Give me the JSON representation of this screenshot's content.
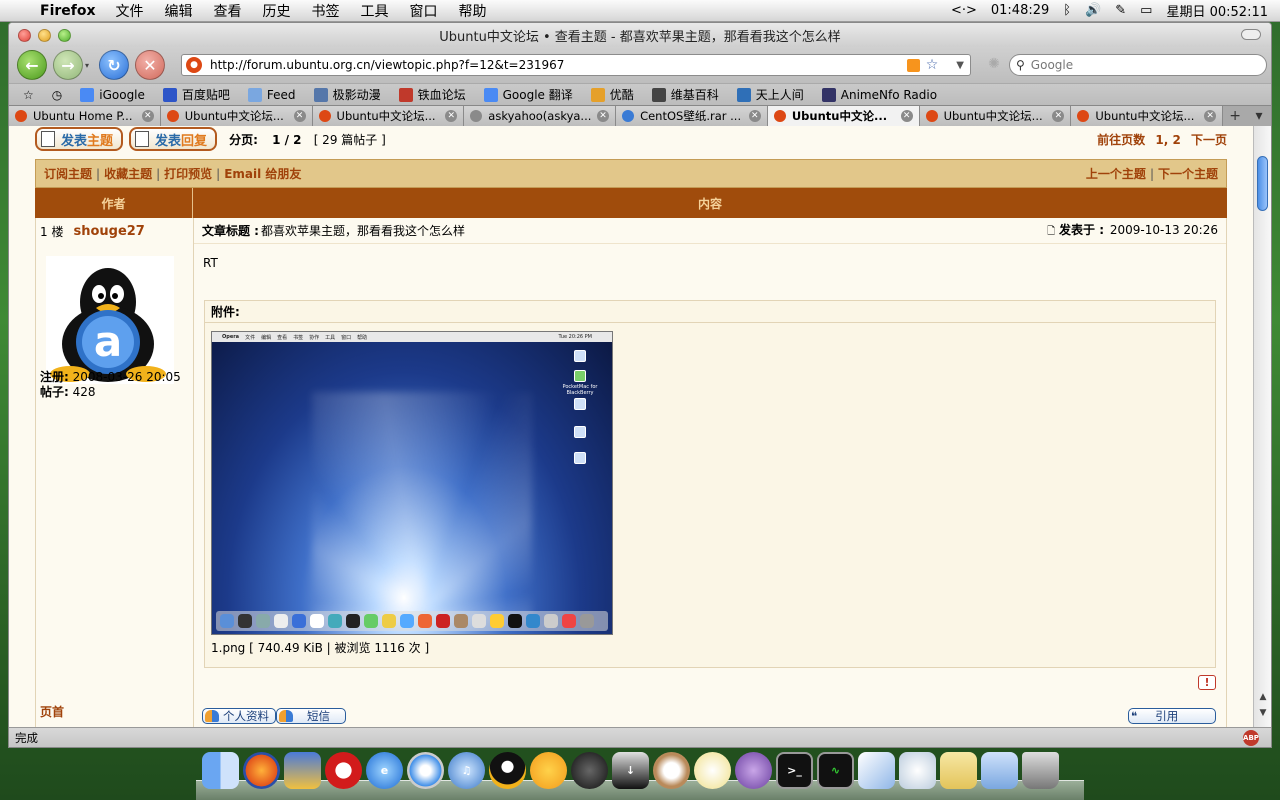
{
  "menubar": {
    "app": "Firefox",
    "items": [
      "文件",
      "编辑",
      "查看",
      "历史",
      "书签",
      "工具",
      "窗口",
      "帮助"
    ],
    "timer": "01:48:29",
    "clock": "星期日 00:52:11"
  },
  "window": {
    "title": "Ubuntu中文论坛 • 查看主题 - 都喜欢苹果主题，那看看我这个怎么样"
  },
  "navbar": {
    "url": "http://forum.ubuntu.org.cn/viewtopic.php?f=12&t=231967",
    "search_placeholder": "Google"
  },
  "bookmarks": [
    {
      "label": "iGoogle",
      "color": "#4a8af4"
    },
    {
      "label": "百度贴吧",
      "color": "#2d55c8"
    },
    {
      "label": "Feed",
      "color": "#7aa7e0"
    },
    {
      "label": "极影动漫",
      "color": "#5577aa"
    },
    {
      "label": "铁血论坛",
      "color": "#c0392b"
    },
    {
      "label": "Google 翻译",
      "color": "#4a8af4"
    },
    {
      "label": "优酷",
      "color": "#e5a02a"
    },
    {
      "label": "维基百科",
      "color": "#444444"
    },
    {
      "label": "天上人间",
      "color": "#2f6fb7"
    },
    {
      "label": "AnimeNfo Radio",
      "color": "#333366"
    }
  ],
  "tabs": [
    {
      "label": "Ubuntu Home P...",
      "active": false
    },
    {
      "label": "Ubuntu中文论坛...",
      "active": false
    },
    {
      "label": "Ubuntu中文论坛...",
      "active": false
    },
    {
      "label": "askyahoo(askya...",
      "active": false
    },
    {
      "label": "CentOS壁纸.rar ...",
      "active": false
    },
    {
      "label": "Ubuntu中文论...",
      "active": true
    },
    {
      "label": "Ubuntu中文论坛...",
      "active": false
    },
    {
      "label": "Ubuntu中文论坛...",
      "active": false
    }
  ],
  "forum": {
    "new_topic": {
      "a": "发表",
      "b": "主题"
    },
    "reply": {
      "a": "发表",
      "b": "回复"
    },
    "pager_label": "分页:",
    "pager_value": "1 / 2",
    "post_count": "[ 29 篇帖子 ]",
    "goto_label": "前往页数",
    "goto_pages": "1, 2",
    "next_page": "下一页",
    "actions": [
      "订阅主题",
      "收藏主题",
      "打印预览",
      "Email 给朋友"
    ],
    "prev_topic": "上一个主题",
    "next_topic": "下一个主题",
    "col_author": "作者",
    "col_content": "内容"
  },
  "post": {
    "floor": "1 楼",
    "username": "shouge27",
    "subject_label": "文章标题 :",
    "subject": "都喜欢苹果主题，那看看我这个怎么样",
    "posted_label": "发表于 :",
    "posted_date": "2009-10-13 20:26",
    "body": "RT",
    "reg_label": "注册:",
    "reg_date": "2008-03-26 20:05",
    "posts_label": "帖子:",
    "posts_count": "428",
    "attach_label": "附件:",
    "file_info": "1.png [ 740.49 KiB | 被浏览 1116 次 ]",
    "profile_btn": "个人资料",
    "pm_btn": "短信",
    "quote_btn": "引用",
    "home_link": "页首"
  },
  "screenshot_thumb": {
    "menu_items": [
      "Opera",
      "文件",
      "编辑",
      "查看",
      "书签",
      "协作",
      "工具",
      "窗口",
      "帮助"
    ],
    "time": "Tue 20:26 PM",
    "desktop_label": "PocketMac for BlackBerry"
  },
  "status": {
    "text": "完成",
    "abp": "ABP"
  }
}
